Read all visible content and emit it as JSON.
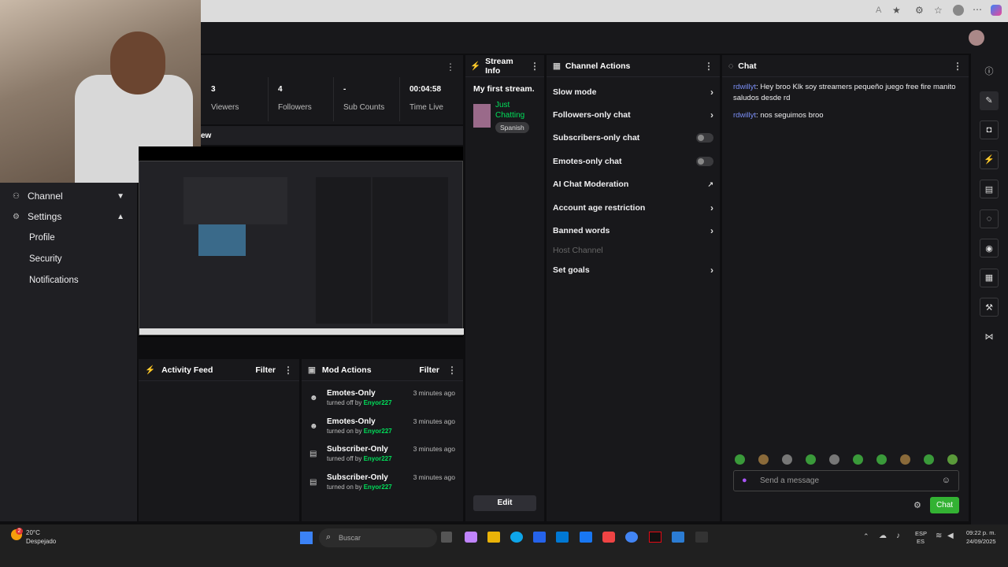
{
  "header": {
    "avatar_label": "avatar"
  },
  "sidebar": {
    "channel_label": "Channel",
    "settings_label": "Settings",
    "sub_items": [
      "Profile",
      "Security",
      "Notifications"
    ]
  },
  "stats": [
    {
      "value": "3",
      "label": "Viewers"
    },
    {
      "value": "4",
      "label": "Followers"
    },
    {
      "value": "-",
      "label": "Sub Counts"
    },
    {
      "value": "00:04:58",
      "label": "Time Live"
    }
  ],
  "preview_label": "ew",
  "stream_info": {
    "title": "Stream Info",
    "stream_title": "My first stream.",
    "category": "Just Chatting",
    "tag": "Spanish",
    "edit_label": "Edit"
  },
  "channel_actions": {
    "title": "Channel Actions",
    "items": [
      {
        "label": "Slow mode",
        "control": "arrow"
      },
      {
        "label": "Followers-only chat",
        "control": "arrow"
      },
      {
        "label": "Subscribers-only chat",
        "control": "toggle"
      },
      {
        "label": "Emotes-only chat",
        "control": "toggle"
      },
      {
        "label": "AI Chat Moderation",
        "control": "external"
      },
      {
        "label": "Account age restriction",
        "control": "arrow"
      },
      {
        "label": "Banned words",
        "control": "arrow"
      },
      {
        "label": "Host Channel",
        "control": "none"
      },
      {
        "label": "Set goals",
        "control": "arrow"
      }
    ]
  },
  "chat": {
    "title": "Chat",
    "messages": [
      {
        "user": "rdwillyt",
        "text": "Hey broo Klk soy streamers pequeño juego free fire manito saludos desde rd"
      },
      {
        "user": "rdwillyt",
        "text": "nos seguimos broo"
      }
    ],
    "input_placeholder": "Send a message",
    "send_label": "Chat"
  },
  "activity_feed": {
    "title": "Activity Feed",
    "filter_label": "Filter"
  },
  "mod_actions": {
    "title": "Mod Actions",
    "filter_label": "Filter",
    "items": [
      {
        "title": "Emotes-Only",
        "action": "turned off by",
        "by": "Enyor227",
        "time": "3 minutes ago"
      },
      {
        "title": "Emotes-Only",
        "action": "turned on by",
        "by": "Enyor227",
        "time": "3 minutes ago"
      },
      {
        "title": "Subscriber-Only",
        "action": "turned off by",
        "by": "Enyor227",
        "time": "3 minutes ago"
      },
      {
        "title": "Subscriber-Only",
        "action": "turned on by",
        "by": "Enyor227",
        "time": "3 minutes ago"
      }
    ]
  },
  "taskbar": {
    "weather_temp": "20°C",
    "weather_desc": "Despejado",
    "weather_badge": "2",
    "search_placeholder": "Buscar",
    "lang_top": "ESP",
    "lang_bottom": "ES",
    "time": "09:22 p. m.",
    "date": "24/09/2025"
  },
  "colors": {
    "accent_green": "#00e05a",
    "chat_button": "#33b233",
    "user_color": "#7b8ff7"
  }
}
